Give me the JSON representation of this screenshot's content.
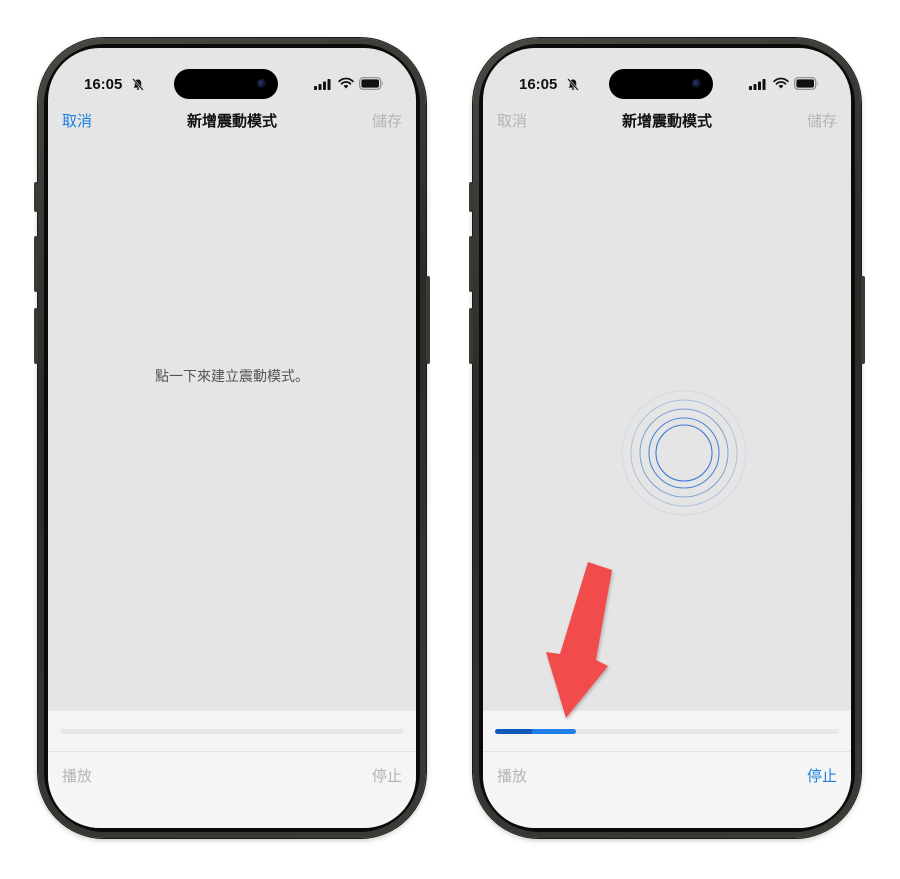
{
  "left_screen": {
    "status": {
      "time": "16:05"
    },
    "nav": {
      "cancel": "取消",
      "title": "新增震動模式",
      "save": "儲存"
    },
    "hint": "點一下來建立震動模式。",
    "controls": {
      "play": "播放",
      "stop": "停止"
    },
    "progress": 0
  },
  "right_screen": {
    "status": {
      "time": "16:05"
    },
    "nav": {
      "cancel": "取消",
      "title": "新增震動模式",
      "save": "儲存"
    },
    "controls": {
      "play": "播放",
      "stop": "停止"
    },
    "progress": 0.235
  },
  "icons": [
    "bell-slash-icon",
    "cellular-signal-icon",
    "wifi-icon",
    "battery-icon",
    "touch-ripple-icon",
    "red-arrow-icon"
  ],
  "colors": {
    "accent": "#1a7fe0",
    "disabled": "#b4b4b4",
    "arrow": "#f04848",
    "screen": "#e5e5e5"
  }
}
